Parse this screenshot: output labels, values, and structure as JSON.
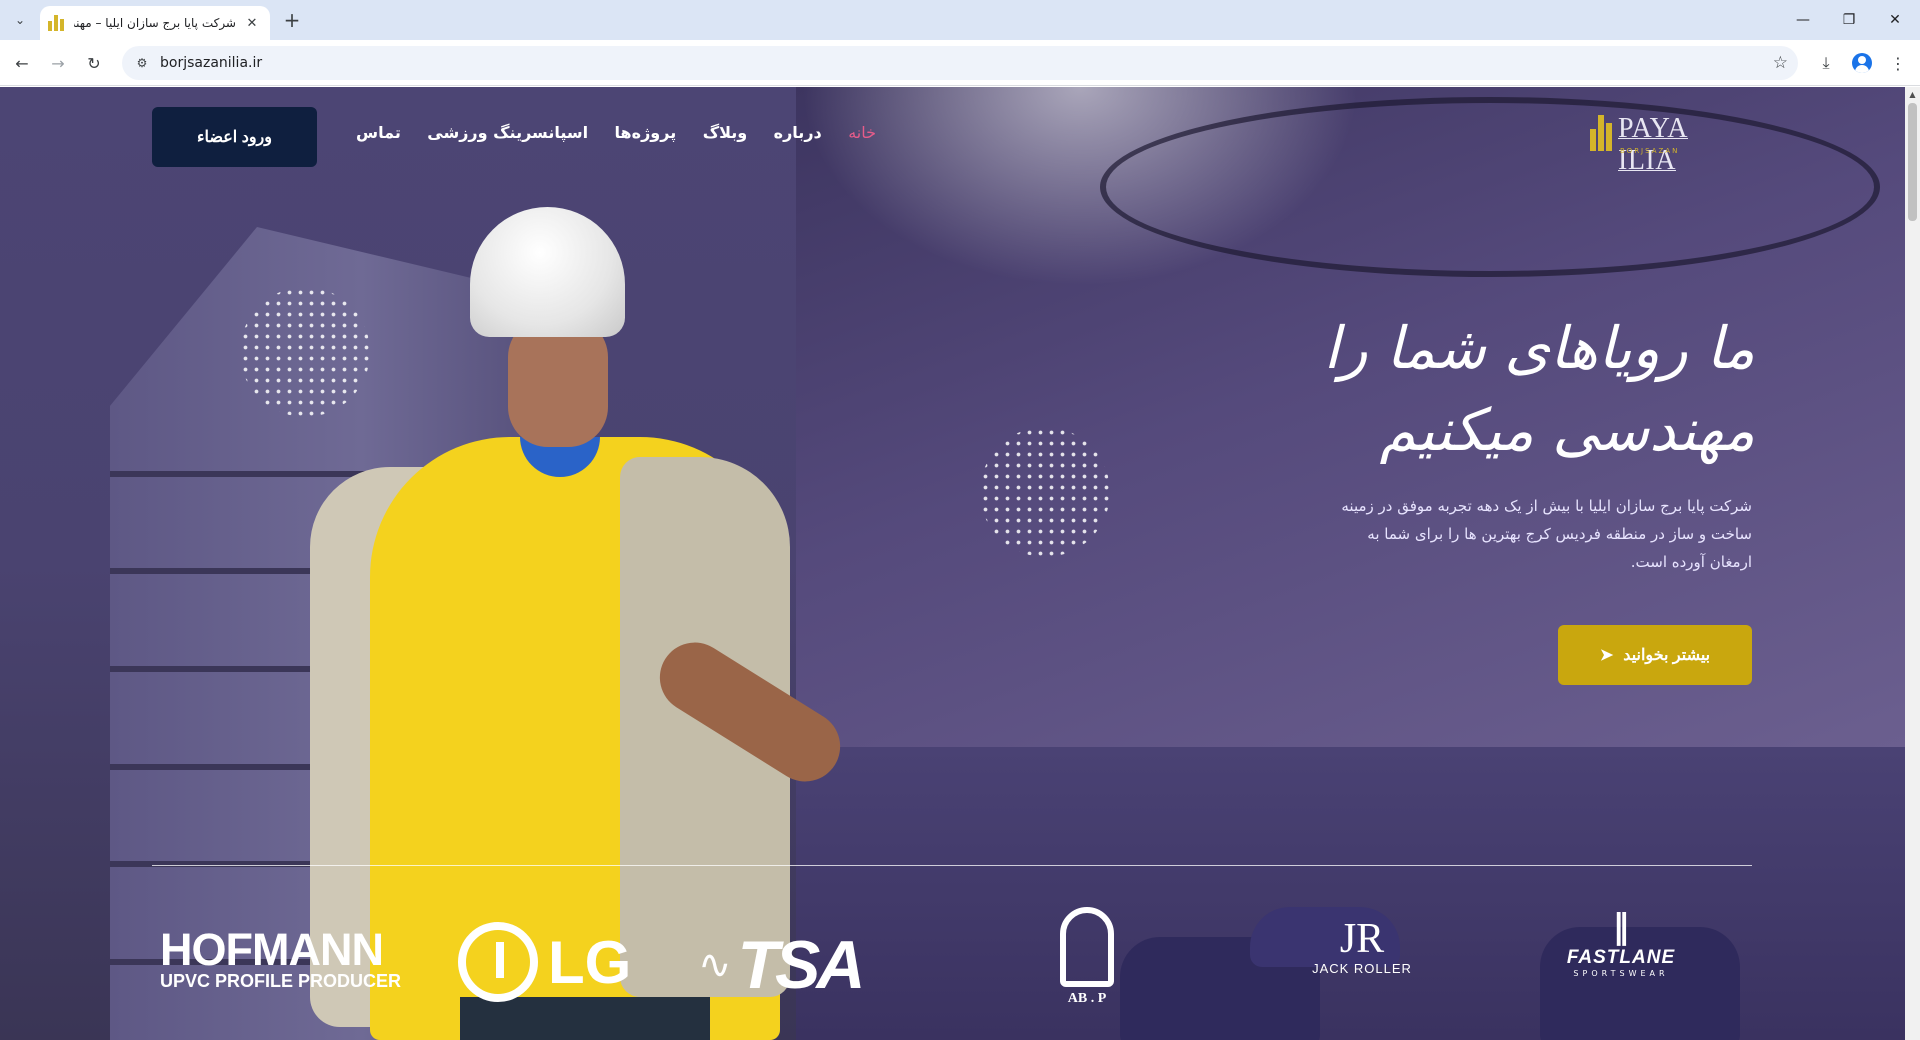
{
  "browser": {
    "tab_title": "شرکت پایا برج سازان ایلیا – مهندسی",
    "url": "borjsazanilia.ir",
    "icons": {
      "tab_search": "chevron-down-icon",
      "close": "close-icon",
      "new_tab": "plus-icon",
      "back": "back-arrow-icon",
      "forward": "forward-arrow-icon",
      "reload": "reload-icon",
      "site_info": "site-info-icon",
      "bookmark": "star-icon",
      "download": "download-icon",
      "profile": "profile-icon",
      "menu": "kebab-menu-icon",
      "minimize": "minimize-icon",
      "restore": "restore-icon",
      "close_window": "close-icon"
    }
  },
  "header": {
    "member_button": "ورود اعضاء",
    "nav": [
      {
        "label": "خانه",
        "active": true
      },
      {
        "label": "درباره",
        "active": false
      },
      {
        "label": "وبلاگ",
        "active": false
      },
      {
        "label": "پروژه‌ها",
        "active": false
      },
      {
        "label": "اسپانسرینگ ورزشی",
        "active": false
      },
      {
        "label": "تماس",
        "active": false
      }
    ],
    "logo": {
      "text": "PAYA ILIA",
      "subtext": "BORJSAZAN"
    }
  },
  "hero": {
    "title_line1": "ما رویاهای شما را",
    "title_line2": "مهندسی میکنیم",
    "description": "شرکت پایا برج سازان ایلیا با بیش از یک دهه تجربه موفق در زمینه ساخت و ساز در منطقه فردیس کرج بهترین ها را برای شما به ارمغان آورده است.",
    "cta": "بیشتر بخوانید"
  },
  "partners": {
    "hofmann": {
      "name": "HOFMANN",
      "tagline": "UPVC PROFILE PRODUCER"
    },
    "lg": {
      "name": "LG"
    },
    "tsa": {
      "name": "TSA"
    },
    "abp": {
      "name": "AB . P"
    },
    "jack_roller": {
      "mark": "JR",
      "name": "JACK ROLLER"
    },
    "fastlane": {
      "name": "FASTLANE",
      "tagline": "SPORTSWEAR"
    }
  },
  "colors": {
    "accent_gold": "#c9a70e",
    "nav_active": "#e65c8a",
    "member_button_bg": "#0f1f3f",
    "hero_overlay": "#4a4272"
  }
}
